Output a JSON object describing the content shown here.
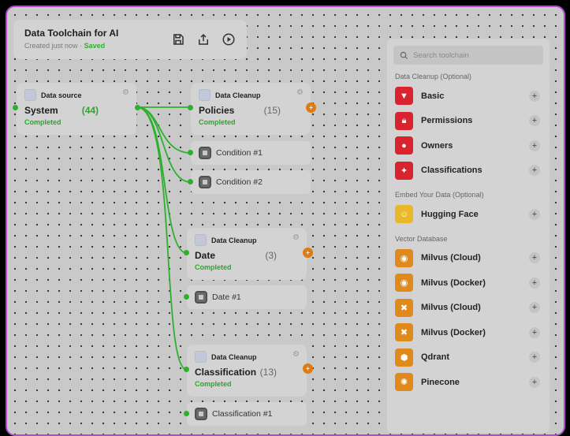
{
  "header": {
    "title": "Data Toolchain for AI",
    "subtitle": "Created just now",
    "separator": "·",
    "saved": "Saved",
    "icons": [
      "save-icon",
      "share-icon",
      "play-icon"
    ]
  },
  "nodes": {
    "source": {
      "type": "Data source",
      "name": "System",
      "count": "(44)",
      "status": "Completed"
    },
    "policies": {
      "type": "Data Cleanup",
      "name": "Policies",
      "count": "(15)",
      "status": "Completed"
    },
    "date": {
      "type": "Data Cleanup",
      "name": "Date",
      "count": "(3)",
      "status": "Completed"
    },
    "classification": {
      "type": "Data Cleanup",
      "name": "Classification",
      "count": "(13)",
      "status": "Completed"
    }
  },
  "conditions": {
    "c1": "Condition #1",
    "c2": "Condition #2",
    "d1": "Date #1",
    "cl1": "Classification #1"
  },
  "panel": {
    "search_placeholder": "Search toolchain",
    "sections": {
      "cleanup": "Data Cleanup (Optional)",
      "embed": "Embed Your Data (Optional)",
      "vector": "Vector Database"
    },
    "cleanup_items": [
      {
        "label": "Basic",
        "icon": "filter-icon",
        "color": "#d9232f"
      },
      {
        "label": "Permissions",
        "icon": "lock-icon",
        "color": "#d9232f"
      },
      {
        "label": "Owners",
        "icon": "user-icon",
        "color": "#d9232f"
      },
      {
        "label": "Classifications",
        "icon": "sparkle-icon",
        "color": "#d9232f"
      }
    ],
    "embed_items": [
      {
        "label": "Hugging Face",
        "icon": "hugging-face-icon",
        "color": "#e8b82a"
      }
    ],
    "vector_items": [
      {
        "label": "Milvus (Cloud)",
        "icon": "eye-icon",
        "color": "#e08a1e"
      },
      {
        "label": "Milvus (Docker)",
        "icon": "eye-icon",
        "color": "#e08a1e"
      },
      {
        "label": "Milvus (Cloud)",
        "icon": "fish-icon",
        "color": "#e08a1e"
      },
      {
        "label": "Milvus (Docker)",
        "icon": "fish-icon",
        "color": "#e08a1e"
      },
      {
        "label": "Qdrant",
        "icon": "qdrant-icon",
        "color": "#e08a1e"
      },
      {
        "label": "Pinecone",
        "icon": "pinecone-icon",
        "color": "#e08a1e"
      }
    ],
    "plus": "+"
  },
  "colors": {
    "accent_green": "#2db02d",
    "accent_orange": "#e07a12",
    "frame": "#b04ad6"
  }
}
